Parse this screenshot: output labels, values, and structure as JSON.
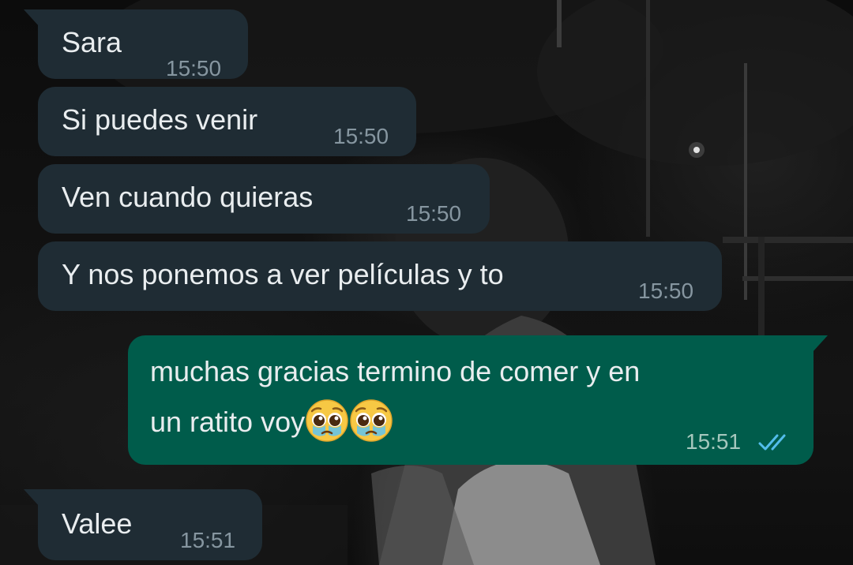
{
  "messages": [
    {
      "direction": "incoming",
      "text": "Sara",
      "time": "15:50"
    },
    {
      "direction": "incoming",
      "text": "Si puedes venir",
      "time": "15:50"
    },
    {
      "direction": "incoming",
      "text": "Ven cuando quieras",
      "time": "15:50"
    },
    {
      "direction": "incoming",
      "text": "Y nos ponemos a ver películas y to",
      "time": "15:50"
    },
    {
      "direction": "outgoing",
      "line1": "muchas gracias termino de comer y en",
      "line2": "un ratito voy",
      "emojis": [
        "pleading-face-tears-emoji",
        "pleading-face-tears-emoji"
      ],
      "time": "15:51",
      "status_icon": "double-check-read-icon",
      "status_color": "#53bdeb"
    },
    {
      "direction": "incoming",
      "text": "Valee",
      "time": "15:51"
    }
  ],
  "colors": {
    "incoming_bubble": "#1f2c34",
    "outgoing_bubble": "#005c4b",
    "text": "#e9edef",
    "time_incoming": "#8696a0",
    "time_outgoing": "#a5c7bd"
  }
}
